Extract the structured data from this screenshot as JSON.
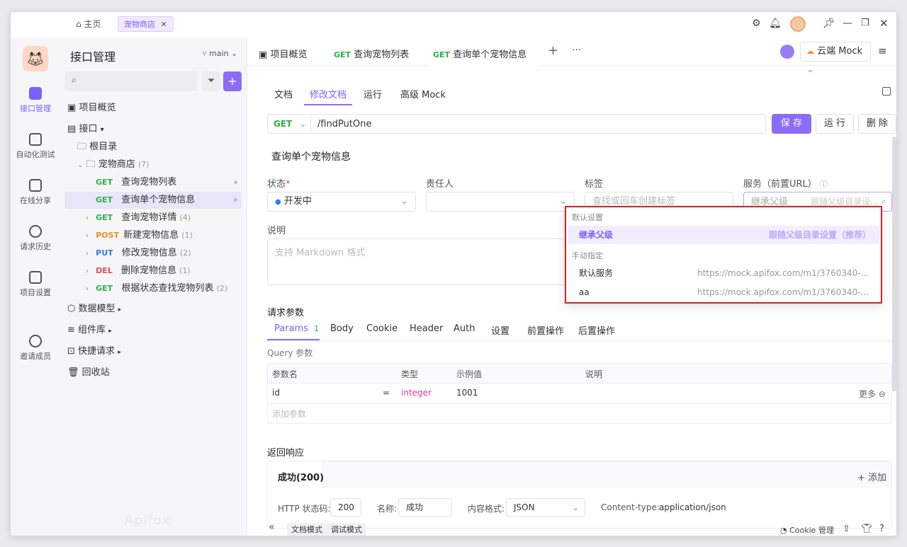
{
  "topbar": {
    "home_label": "主页",
    "tab_label": "宠物商店",
    "env_label": "云端 Mock"
  },
  "rail": {
    "items": [
      {
        "label": "接口管理"
      },
      {
        "label": "自动化测试"
      },
      {
        "label": "在线分享"
      },
      {
        "label": "请求历史"
      },
      {
        "label": "项目设置"
      },
      {
        "label": "邀请成员"
      }
    ]
  },
  "sidebar": {
    "title": "接口管理",
    "branch": "main",
    "overview": "项目概览",
    "api_root": "接口",
    "root_dir": "根目录",
    "folder": "宠物商店",
    "folder_count": "(7)",
    "endpoints": [
      {
        "method": "GET",
        "name": "查询宠物列表",
        "count": ""
      },
      {
        "method": "GET",
        "name": "查询单个宠物信息",
        "count": ""
      },
      {
        "method": "GET",
        "name": "查询宠物详情",
        "count": "(4)"
      },
      {
        "method": "POST",
        "name": "新建宠物信息",
        "count": "(1)"
      },
      {
        "method": "PUT",
        "name": "修改宠物信息",
        "count": "(2)"
      },
      {
        "method": "DEL",
        "name": "删除宠物信息",
        "count": "(1)"
      },
      {
        "method": "GET",
        "name": "根据状态查找宠物列表",
        "count": "(2)"
      }
    ],
    "data_model": "数据模型",
    "components": "组件库",
    "quick_request": "快捷请求",
    "recycle": "回收站"
  },
  "tabs": [
    {
      "method": "",
      "label": "项目概览"
    },
    {
      "method": "GET",
      "label": "查询宠物列表"
    },
    {
      "method": "GET",
      "label": "查询单个宠物信息"
    }
  ],
  "subtabs": [
    "文档",
    "修改文档",
    "运行",
    "高级 Mock"
  ],
  "request": {
    "method": "GET",
    "path": "/findPutOne",
    "save": "保 存",
    "run": "运 行",
    "delete": "删 除"
  },
  "doc": {
    "title": "查询单个宠物信息",
    "status_label": "状态",
    "status_value": "开发中",
    "owner_label": "责任人",
    "tag_label": "标签",
    "tag_placeholder": "查找或回车创建标签",
    "service_label": "服务（前置URL）",
    "service_value": "继承父级",
    "service_hint": "跟随父级目录设...",
    "desc_label": "说明",
    "desc_placeholder": "支持 Markdown 格式"
  },
  "dropdown": {
    "section_default": "默认设置",
    "inherit": "继承父级",
    "inherit_hint": "跟随父级目录设置（推荐）",
    "section_manual": "手动指定",
    "services": [
      {
        "name": "默认服务",
        "url": "https://mock.apifox.com/m1/3760340-0-def..."
      },
      {
        "name": "aa",
        "url": "https://mock.apifox.com/m1/3760340-0-cac..."
      }
    ]
  },
  "params": {
    "section": "请求参数",
    "tabs": [
      "Params",
      "Body",
      "Cookie",
      "Header",
      "Auth",
      "设置",
      "前置操作",
      "后置操作"
    ],
    "params_count": "1",
    "query_label": "Query 参数",
    "headers": [
      "参数名",
      "类型",
      "示例值",
      "说明"
    ],
    "row": {
      "name": "id",
      "eq": "=",
      "type": "integer",
      "example": "1001"
    },
    "more": "更多",
    "add": "添加参数"
  },
  "response": {
    "section": "返回响应",
    "tab": "成功(200)",
    "add": "+ 添加",
    "http_label": "HTTP 状态码:",
    "http_value": "200",
    "name_label": "名称:",
    "name_value": "成功",
    "format_label": "内容格式:",
    "format_value": "JSON",
    "ctype_label": "Content-type:",
    "ctype_value": "application/json"
  },
  "bottom": {
    "doc_mode": "文档模式",
    "debug_mode": "调试模式",
    "cookie": "Cookie 管理",
    "watermark": "Apifox"
  },
  "colors": {
    "accent": "#8b6cf7",
    "get": "#2eaf4a",
    "post": "#f08c1e",
    "put": "#2c7ef8",
    "del": "#e14d4d",
    "highlight": "#d4232b"
  }
}
